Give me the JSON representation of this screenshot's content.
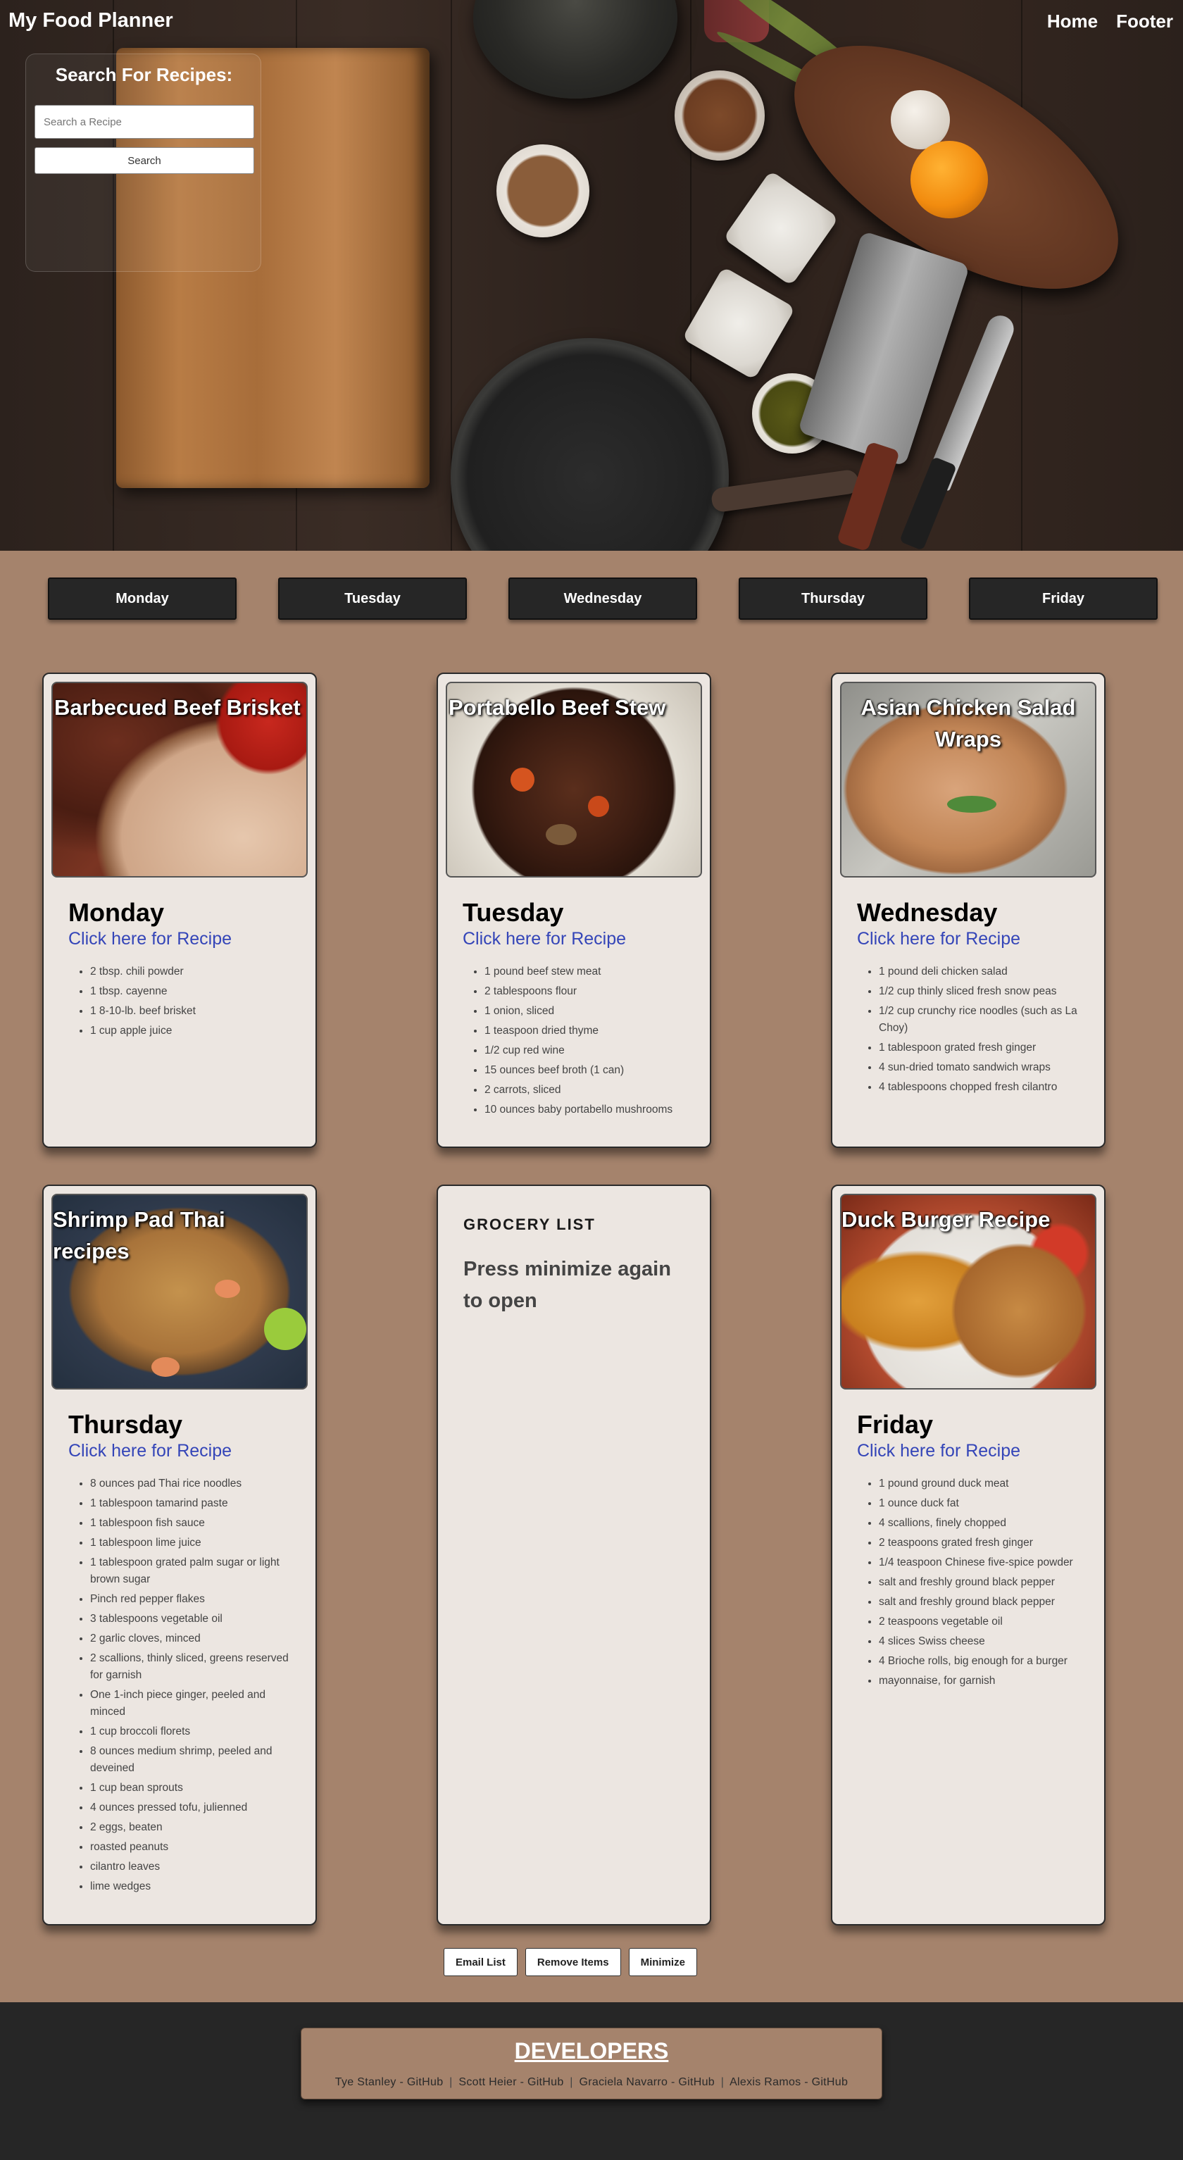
{
  "header": {
    "title": "My Food Planner",
    "nav": [
      "Home",
      "Footer"
    ]
  },
  "search": {
    "heading": "Search For Recipes:",
    "placeholder": "Search a Recipe",
    "button_label": "Search"
  },
  "days": [
    "Monday",
    "Tuesday",
    "Wednesday",
    "Thursday",
    "Friday"
  ],
  "recipes": [
    {
      "title": "Barbecued Beef Brisket",
      "day": "Monday",
      "link": "Click here for Recipe",
      "ingredients": [
        "2 tbsp. chili powder",
        "1 tbsp. cayenne",
        "1 8-10-lb. beef brisket",
        "1 cup apple juice"
      ]
    },
    {
      "title": "Portabello Beef Stew",
      "day": "Tuesday",
      "link": "Click here for Recipe",
      "ingredients": [
        "1 pound beef stew meat",
        "2 tablespoons flour",
        "1 onion, sliced",
        "1 teaspoon dried thyme",
        "1/2 cup red wine",
        "15 ounces beef broth (1 can)",
        "2 carrots, sliced",
        "10 ounces baby portabello mushrooms"
      ]
    },
    {
      "title": "Asian Chicken Salad Wraps",
      "day": "Wednesday",
      "link": "Click here for Recipe",
      "ingredients": [
        "1 pound deli chicken salad",
        "1/2 cup thinly sliced fresh snow peas",
        "1/2 cup crunchy rice noodles (such as La Choy)",
        "1 tablespoon grated fresh ginger",
        "4 sun-dried tomato sandwich wraps",
        "4 tablespoons chopped fresh cilantro"
      ]
    },
    {
      "title": "Shrimp Pad Thai recipes",
      "day": "Thursday",
      "link": "Click here for Recipe",
      "ingredients": [
        "8 ounces pad Thai rice noodles",
        "1 tablespoon tamarind paste",
        "1 tablespoon fish sauce",
        "1 tablespoon lime juice",
        "1 tablespoon grated palm sugar or light brown sugar",
        "Pinch red pepper flakes",
        "3 tablespoons vegetable oil",
        "2 garlic cloves, minced",
        "2 scallions, thinly sliced, greens reserved for garnish",
        "One 1-inch piece ginger, peeled and minced",
        "1 cup broccoli florets",
        "8 ounces medium shrimp, peeled and deveined",
        "1 cup bean sprouts",
        "4 ounces pressed tofu, julienned",
        "2 eggs, beaten",
        "roasted peanuts",
        "cilantro leaves",
        "lime wedges"
      ]
    },
    {
      "title": "Duck Burger Recipe",
      "day": "Friday",
      "link": "Click here for Recipe",
      "ingredients": [
        "1 pound ground duck meat",
        "1 ounce duck fat",
        "4 scallions, finely chopped",
        "2 teaspoons grated fresh ginger",
        "1/4 teaspoon Chinese five-spice powder",
        "salt and freshly ground black pepper",
        "salt and freshly ground black pepper",
        "2 teaspoons vegetable oil",
        "4 slices Swiss cheese",
        "4 Brioche rolls, big enough for a burger",
        "mayonnaise, for garnish"
      ]
    }
  ],
  "grocery": {
    "title": "GROCERY LIST",
    "message": "Press minimize again to open",
    "buttons": [
      "Email List",
      "Remove Items",
      "Minimize"
    ]
  },
  "footer": {
    "title": "DEVELOPERS",
    "developers": [
      "Tye Stanley - GitHub",
      "Scott Heier - GitHub",
      "Graciela Navarro - GitHub",
      "Alexis Ramos - GitHub"
    ],
    "separator": "|"
  },
  "colors": {
    "page_bg": "#a5836c",
    "card_bg": "#ece6e1",
    "dark": "#262626",
    "link": "#3445b8"
  }
}
